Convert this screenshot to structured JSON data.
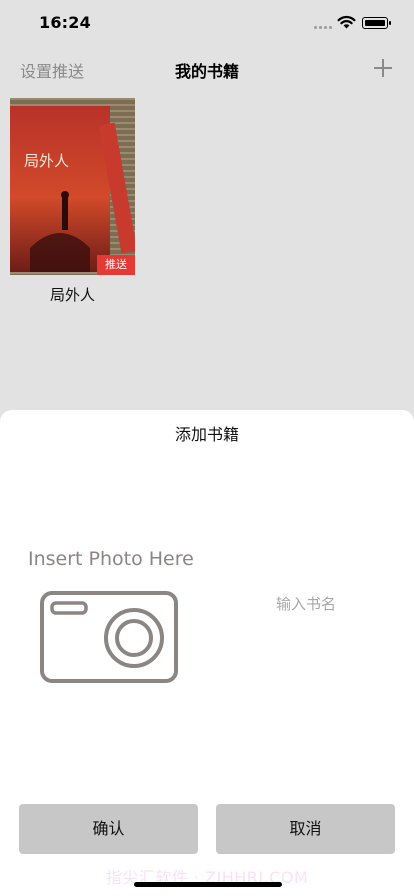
{
  "status_bar": {
    "time": "16:24",
    "icons": [
      "signal-icon",
      "wifi-icon",
      "battery-icon"
    ]
  },
  "nav": {
    "left_label": "设置推送",
    "title": "我的书籍",
    "add_icon": "plus-icon"
  },
  "books": [
    {
      "title": "局外人",
      "cover_text": "局外人",
      "badge": "推送"
    }
  ],
  "sheet": {
    "title": "添加书籍",
    "photo_label": "Insert Photo Here",
    "photo_icon": "camera-icon",
    "name_placeholder": "输入书名",
    "confirm_label": "确认",
    "cancel_label": "取消"
  },
  "watermark": "指尖汇软件 · ZJHHRJ.COM",
  "colors": {
    "background": "#e2e2e2",
    "badge": "#e53935",
    "button": "#c7c7c7",
    "muted_text": "#8a8a8a"
  }
}
